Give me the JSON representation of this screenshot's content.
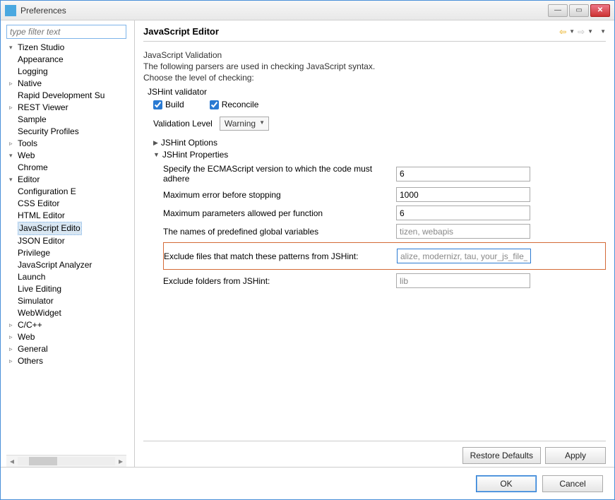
{
  "window": {
    "title": "Preferences"
  },
  "sidebar": {
    "filter_placeholder": "type filter text",
    "tree": [
      {
        "label": "Tizen Studio",
        "depth": 0,
        "expander": "▾"
      },
      {
        "label": "Appearance",
        "depth": 1,
        "expander": ""
      },
      {
        "label": "Logging",
        "depth": 1,
        "expander": ""
      },
      {
        "label": "Native",
        "depth": 1,
        "expander": "▹"
      },
      {
        "label": "Rapid Development Su",
        "depth": 1,
        "expander": ""
      },
      {
        "label": "REST Viewer",
        "depth": 1,
        "expander": "▹"
      },
      {
        "label": "Sample",
        "depth": 1,
        "expander": ""
      },
      {
        "label": "Security Profiles",
        "depth": 1,
        "expander": ""
      },
      {
        "label": "Tools",
        "depth": 1,
        "expander": "▹"
      },
      {
        "label": "Web",
        "depth": 1,
        "expander": "▾"
      },
      {
        "label": "Chrome",
        "depth": 2,
        "expander": ""
      },
      {
        "label": "Editor",
        "depth": 2,
        "expander": "▾"
      },
      {
        "label": "Configuration E",
        "depth": 3,
        "expander": ""
      },
      {
        "label": "CSS Editor",
        "depth": 3,
        "expander": ""
      },
      {
        "label": "HTML Editor",
        "depth": 3,
        "expander": ""
      },
      {
        "label": "JavaScript Edito",
        "depth": 3,
        "expander": "",
        "selected": true
      },
      {
        "label": "JSON Editor",
        "depth": 3,
        "expander": ""
      },
      {
        "label": "Privilege",
        "depth": 3,
        "expander": ""
      },
      {
        "label": "JavaScript Analyzer",
        "depth": 2,
        "expander": ""
      },
      {
        "label": "Launch",
        "depth": 2,
        "expander": ""
      },
      {
        "label": "Live Editing",
        "depth": 2,
        "expander": ""
      },
      {
        "label": "Simulator",
        "depth": 2,
        "expander": ""
      },
      {
        "label": "WebWidget",
        "depth": 1,
        "expander": ""
      },
      {
        "label": "C/C++",
        "depth": 0,
        "expander": "▹"
      },
      {
        "label": "Web",
        "depth": 0,
        "expander": "▹"
      },
      {
        "label": "General",
        "depth": 0,
        "expander": "▹"
      },
      {
        "label": "Others",
        "depth": 0,
        "expander": "▹"
      }
    ]
  },
  "content": {
    "title": "JavaScript Editor",
    "validation": {
      "heading": "JavaScript Validation",
      "desc1": "The following parsers are used in checking JavaScript syntax.",
      "desc2": "Choose the level of checking:",
      "validator_group": "JSHint validator",
      "build_label": "Build",
      "build_checked": true,
      "reconcile_label": "Reconcile",
      "reconcile_checked": true,
      "level_label": "Validation Level",
      "level_value": "Warning",
      "options_label": "JSHint Options",
      "properties_label": "JSHint Properties",
      "props": {
        "ecma": {
          "label": "Specify the ECMAScript version to which the code must adhere",
          "value": "6"
        },
        "maxerr": {
          "label": "Maximum error before stopping",
          "value": "1000"
        },
        "maxparams": {
          "label": "Maximum parameters allowed per function",
          "value": "6"
        },
        "globals": {
          "label": "The names of predefined global variables",
          "value": "tizen, webapis"
        },
        "exclude_files": {
          "label": "Exclude files that match these patterns from JSHint:",
          "value": "alize, modernizr, tau, your_js_file_nar"
        },
        "exclude_folders": {
          "label": "Exclude folders from JSHint:",
          "value": "lib"
        }
      }
    },
    "buttons": {
      "restore": "Restore Defaults",
      "apply": "Apply",
      "ok": "OK",
      "cancel": "Cancel"
    }
  }
}
